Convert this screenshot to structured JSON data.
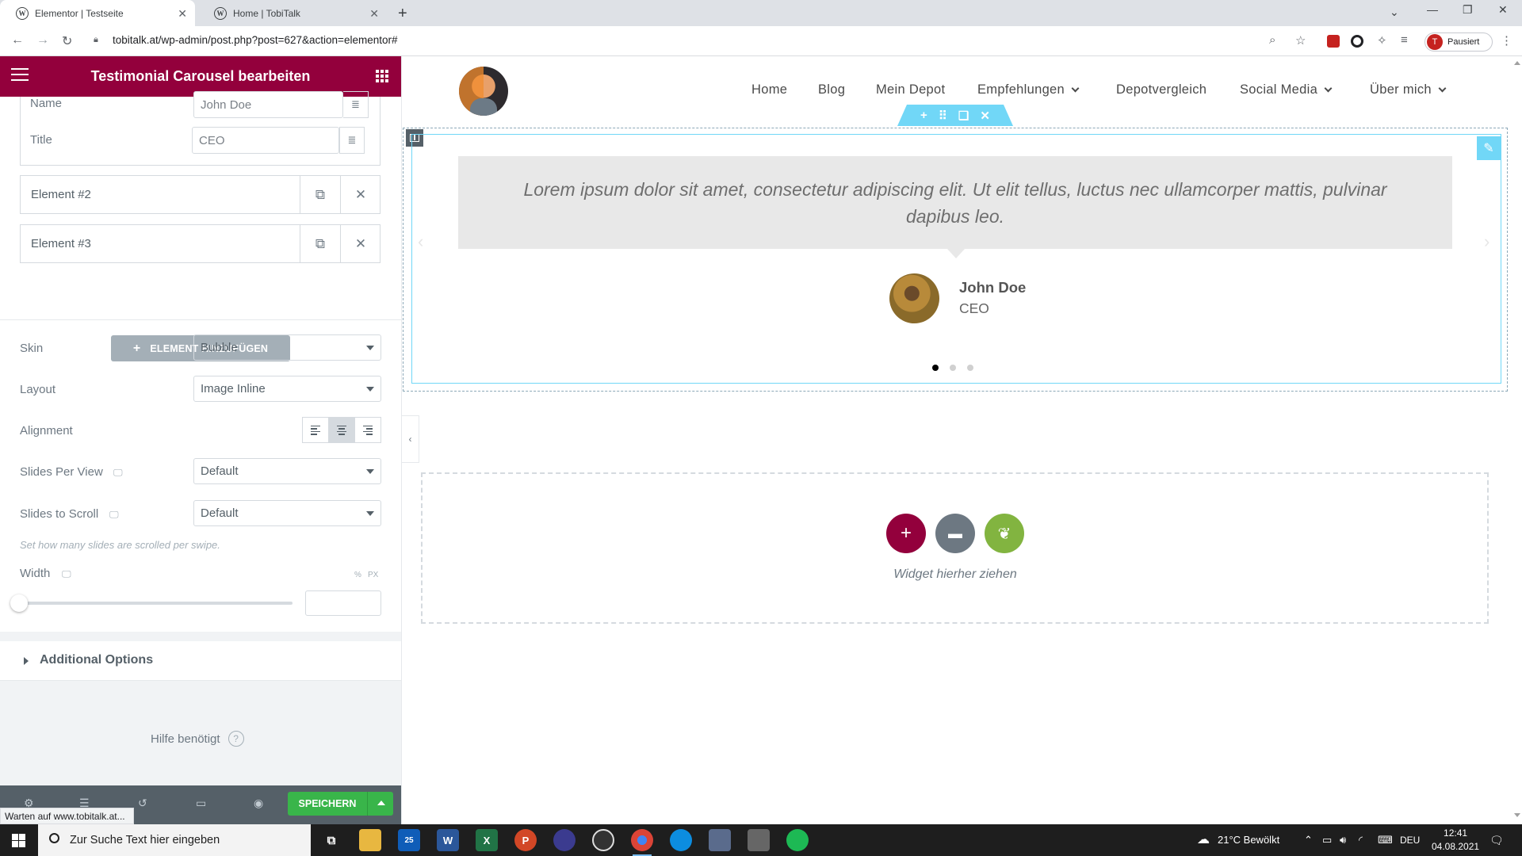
{
  "browser": {
    "tabs": [
      {
        "title": "Elementor | Testseite",
        "active": true
      },
      {
        "title": "Home | TobiTalk",
        "active": false
      }
    ],
    "url": "tobitalk.at/wp-admin/post.php?post=627&action=elementor#",
    "profile_label": "Pausiert",
    "profile_initial": "T"
  },
  "panel": {
    "title": "Testimonial Carousel bearbeiten",
    "fields": {
      "name_label": "Name",
      "name_value": "John Doe",
      "title_label": "Title",
      "title_value": "CEO"
    },
    "repeater_items": [
      "Element #2",
      "Element #3"
    ],
    "add_element_label": "ELEMENT HINZUFÜGEN",
    "controls": {
      "skin_label": "Skin",
      "skin_value": "Bubble",
      "layout_label": "Layout",
      "layout_value": "Image Inline",
      "alignment_label": "Alignment",
      "alignment_selected": "center",
      "slides_per_view_label": "Slides Per View",
      "slides_per_view_value": "Default",
      "slides_to_scroll_label": "Slides to Scroll",
      "slides_to_scroll_value": "Default",
      "slides_to_scroll_desc": "Set how many slides are scrolled per swipe.",
      "width_label": "Width",
      "width_unit_percent": "%",
      "width_unit_px": "PX",
      "width_value": 0
    },
    "additional_options_label": "Additional Options",
    "help_label": "Hilfe benötigt",
    "save_label": "SPEICHERN",
    "status_text": "Warten auf www.tobitalk.at..."
  },
  "site": {
    "nav": [
      {
        "label": "Home",
        "dropdown": false
      },
      {
        "label": "Blog",
        "dropdown": false
      },
      {
        "label": "Mein Depot",
        "dropdown": false
      },
      {
        "label": "Empfehlungen",
        "dropdown": true
      },
      {
        "label": "Depotvergleich",
        "dropdown": false
      },
      {
        "label": "Social Media",
        "dropdown": true
      },
      {
        "label": "Über mich",
        "dropdown": true
      }
    ],
    "testimonial": {
      "content": "Lorem ipsum dolor sit amet, consectetur adipiscing elit. Ut elit tellus, luctus nec ullamcorper mattis, pulvinar dapibus leo.",
      "name": "John Doe",
      "title": "CEO"
    },
    "carousel_dots": 3,
    "carousel_active_dot": 0,
    "dropzone_text": "Widget hierher ziehen"
  },
  "colors": {
    "elementor_header": "#93003c",
    "save_green": "#39b54a",
    "handle_blue": "#71d7f7",
    "add_section": "#93003c",
    "template_gray": "#6d7882",
    "envato_green": "#82b440"
  },
  "taskbar": {
    "search_placeholder": "Zur Suche Text hier eingeben",
    "weather": "21°C  Bewölkt",
    "language": "DEU",
    "time": "12:41",
    "date": "04.08.2021",
    "mail_badge": "25"
  }
}
